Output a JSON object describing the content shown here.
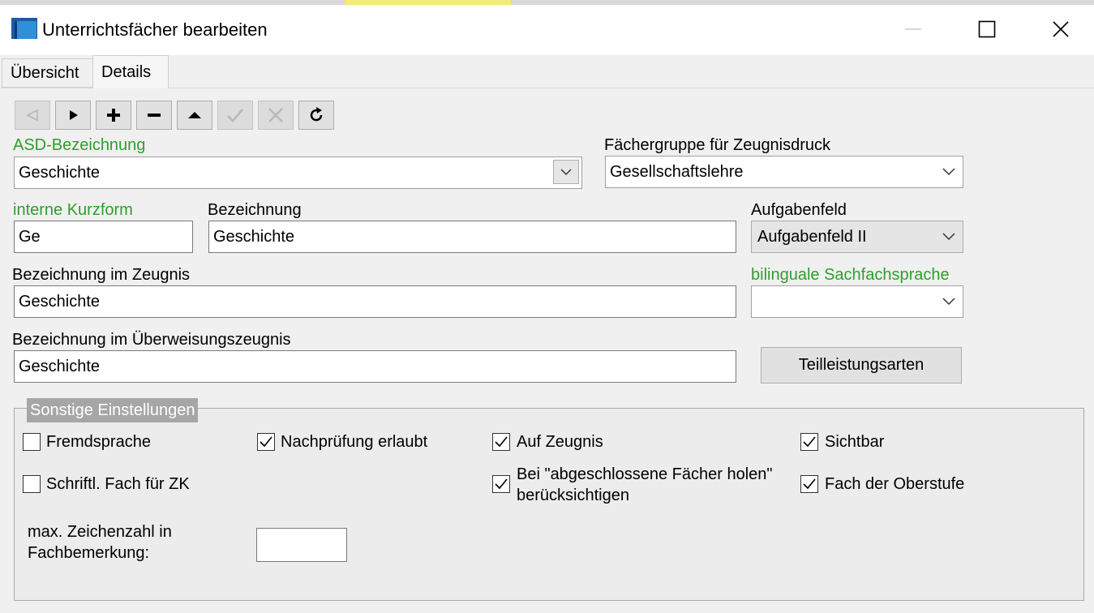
{
  "window": {
    "title": "Unterrichtsfächer bearbeiten"
  },
  "tabs": [
    {
      "label": "Übersicht",
      "active": false
    },
    {
      "label": "Details",
      "active": true
    }
  ],
  "toolbar": {
    "buttons": [
      {
        "icon": "first-record-icon",
        "enabled": false
      },
      {
        "icon": "next-record-icon",
        "enabled": true
      },
      {
        "icon": "add-icon",
        "enabled": true
      },
      {
        "icon": "remove-icon",
        "enabled": true
      },
      {
        "icon": "move-up-icon",
        "enabled": true
      },
      {
        "icon": "confirm-icon",
        "enabled": false
      },
      {
        "icon": "cancel-icon",
        "enabled": false
      },
      {
        "icon": "refresh-icon",
        "enabled": true
      }
    ]
  },
  "fields": {
    "asd": {
      "label": "ASD-Bezeichnung",
      "value": "Geschichte"
    },
    "faechergruppe": {
      "label": "Fächergruppe für Zeugnisdruck",
      "value": "Gesellschaftslehre"
    },
    "kurzform": {
      "label": "interne Kurzform",
      "value": "Ge"
    },
    "bezeichnung": {
      "label": "Bezeichnung",
      "value": "Geschichte"
    },
    "aufgabenfeld": {
      "label": "Aufgabenfeld",
      "value": "Aufgabenfeld II"
    },
    "zeugnis": {
      "label": "Bezeichnung im Zeugnis",
      "value": "Geschichte"
    },
    "bilingual": {
      "label": "bilinguale Sachfachsprache",
      "value": ""
    },
    "ueberweisung": {
      "label": "Bezeichnung im Überweisungszeugnis",
      "value": "Geschichte"
    }
  },
  "buttons": {
    "teilleistungsarten": "Teilleistungsarten"
  },
  "sonstige": {
    "title": "Sonstige Einstellungen",
    "fremdsprache": {
      "label": "Fremdsprache",
      "checked": false
    },
    "nachpruefung": {
      "label": "Nachprüfung erlaubt",
      "checked": true
    },
    "aufzeugnis": {
      "label": "Auf Zeugnis",
      "checked": true
    },
    "sichtbar": {
      "label": "Sichtbar",
      "checked": true
    },
    "schriftl": {
      "label": "Schriftl. Fach für ZK",
      "checked": false
    },
    "abgeschlossen": {
      "label_line1": "Bei \"abgeschlossene Fächer holen\"",
      "label_line2": "berücksichtigen",
      "checked": true
    },
    "oberstufe": {
      "label": "Fach der Oberstufe",
      "checked": true
    },
    "maxzeichen": {
      "label_line1": "max. Zeichenzahl in",
      "label_line2": "Fachbemerkung:",
      "value": ""
    }
  },
  "colors": {
    "green_label": "#2e9e2e",
    "group_title_bg": "#a6a6a6",
    "accent_icon": "#1c5aa6"
  }
}
